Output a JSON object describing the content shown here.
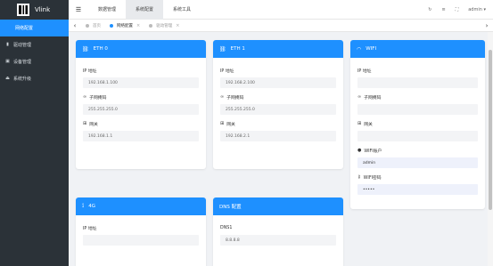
{
  "app": {
    "logo_text": "Vlink"
  },
  "sidebar": {
    "items": [
      {
        "label": "网络配置",
        "icon": "",
        "active": true
      },
      {
        "label": "驱动管理",
        "icon": "database-icon",
        "active": false
      },
      {
        "label": "设备管理",
        "icon": "device-icon",
        "active": false
      },
      {
        "label": "系统升级",
        "icon": "upload-icon",
        "active": false
      }
    ]
  },
  "topbar": {
    "menu": [
      "数据管理",
      "系统配置",
      "系统工具"
    ],
    "active_index": 1,
    "user": "admin"
  },
  "tabs": [
    {
      "label": "首页",
      "active": false,
      "closable": false
    },
    {
      "label": "网络配置",
      "active": true,
      "closable": true
    },
    {
      "label": "驱动管理",
      "active": false,
      "closable": true
    }
  ],
  "cards": {
    "eth0": {
      "title": "ETH 0",
      "ip_label": "IP 地址",
      "ip_value": "192.168.1.100",
      "mask_label": "子网掩码",
      "mask_value": "255.255.255.0",
      "gw_label": "网关",
      "gw_value": "192.168.1.1"
    },
    "eth1": {
      "title": "ETH 1",
      "ip_label": "IP 地址",
      "ip_value": "192.168.2.100",
      "mask_label": "子网掩码",
      "mask_value": "255.255.255.0",
      "gw_label": "网关",
      "gw_value": "192.168.2.1"
    },
    "wifi": {
      "title": "WIFI",
      "ip_label": "IP 地址",
      "ip_value": "",
      "mask_label": "子网掩码",
      "mask_value": "",
      "gw_label": "网关",
      "gw_value": "",
      "account_label": "WIFI账户",
      "account_value": "admin",
      "password_label": "WIFI密码",
      "password_value": "•••••"
    },
    "g4": {
      "title": "4G",
      "ip_label": "IP 地址",
      "ip_value": ""
    },
    "dns": {
      "title": "DNS 配置",
      "dns1_label": "DNS1",
      "dns1_value": "8.8.8.8"
    }
  }
}
